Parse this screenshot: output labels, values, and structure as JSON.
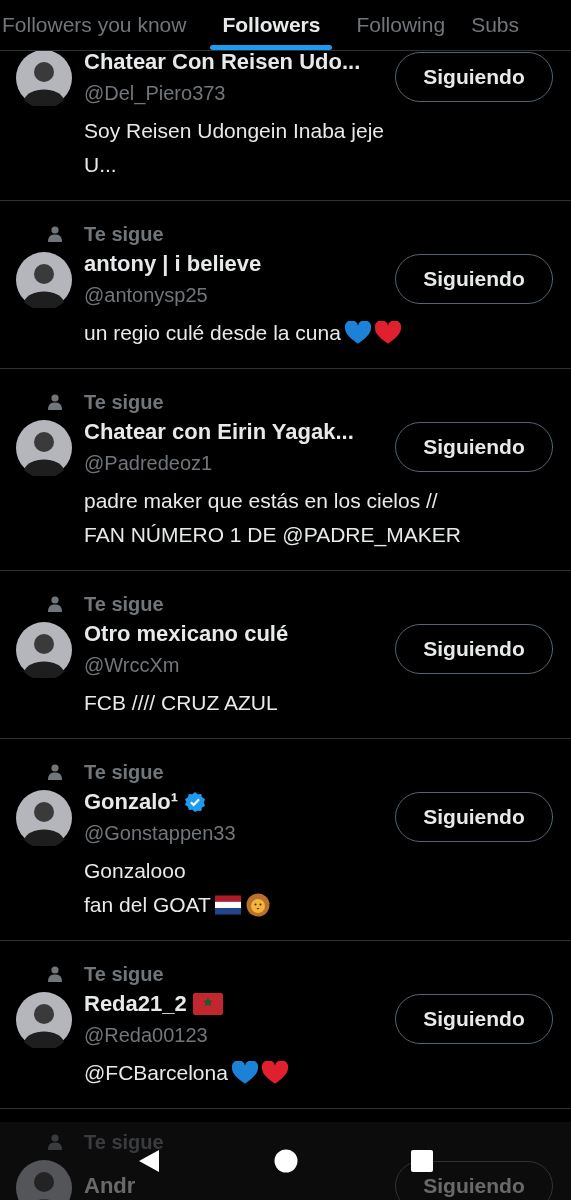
{
  "tabs": [
    {
      "label": "Followers you know",
      "selected": false
    },
    {
      "label": "Followers",
      "selected": true
    },
    {
      "label": "Following",
      "selected": false
    },
    {
      "label": "Subs",
      "selected": false
    }
  ],
  "followers": [
    {
      "name": "Chatear Con Reisen Udo...",
      "handle": "@Del_Piero373",
      "button": "Siguiendo",
      "bio": [
        {
          "text": "Soy Reisen Udongein Inaba jeje"
        },
        {
          "text": "U..."
        }
      ]
    },
    {
      "follow_label": "Te sigue",
      "name": "antony | i believe",
      "handle": "@antonysp25",
      "button": "Siguiendo",
      "bio": [
        {
          "text": "un regio culé desde la cuna",
          "emojis": [
            {
              "kind": "heart",
              "color": "#1b82d8"
            },
            {
              "kind": "heart",
              "color": "#e0202e"
            }
          ]
        }
      ]
    },
    {
      "follow_label": "Te sigue",
      "name": "Chatear con Eirin Yagak...",
      "handle": "@Padredeoz1",
      "button": "Siguiendo",
      "bio": [
        {
          "text": "padre maker que estás en los cielos //"
        },
        {
          "text": "FAN NÚMERO 1 DE @PADRE_MAKER"
        }
      ]
    },
    {
      "follow_label": "Te sigue",
      "name": "Otro mexicano culé",
      "handle": "@WrccXm",
      "button": "Siguiendo",
      "bio": [
        {
          "text": "FCB //// CRUZ AZUL"
        }
      ]
    },
    {
      "follow_label": "Te sigue",
      "name": "Gonzalo¹",
      "name_badges": [
        {
          "kind": "verified"
        }
      ],
      "handle": "@Gonstappen33",
      "button": "Siguiendo",
      "bio": [
        {
          "text": "Gonzalooo"
        },
        {
          "text": "fan del GOAT",
          "emojis": [
            {
              "kind": "flag"
            },
            {
              "kind": "lion"
            }
          ]
        }
      ]
    },
    {
      "follow_label": "Te sigue",
      "name": "Reda21_2",
      "name_badges": [
        {
          "kind": "flag"
        }
      ],
      "handle": "@Reda00123",
      "button": "Siguiendo",
      "bio": [
        {
          "text": "@FCBarcelona",
          "emojis": [
            {
              "kind": "heart",
              "color": "#1b82d8"
            },
            {
              "kind": "heart",
              "color": "#e0202e"
            }
          ]
        }
      ]
    },
    {
      "follow_label": "Te sigue",
      "name": "Andr",
      "button": "Siguiendo"
    }
  ]
}
